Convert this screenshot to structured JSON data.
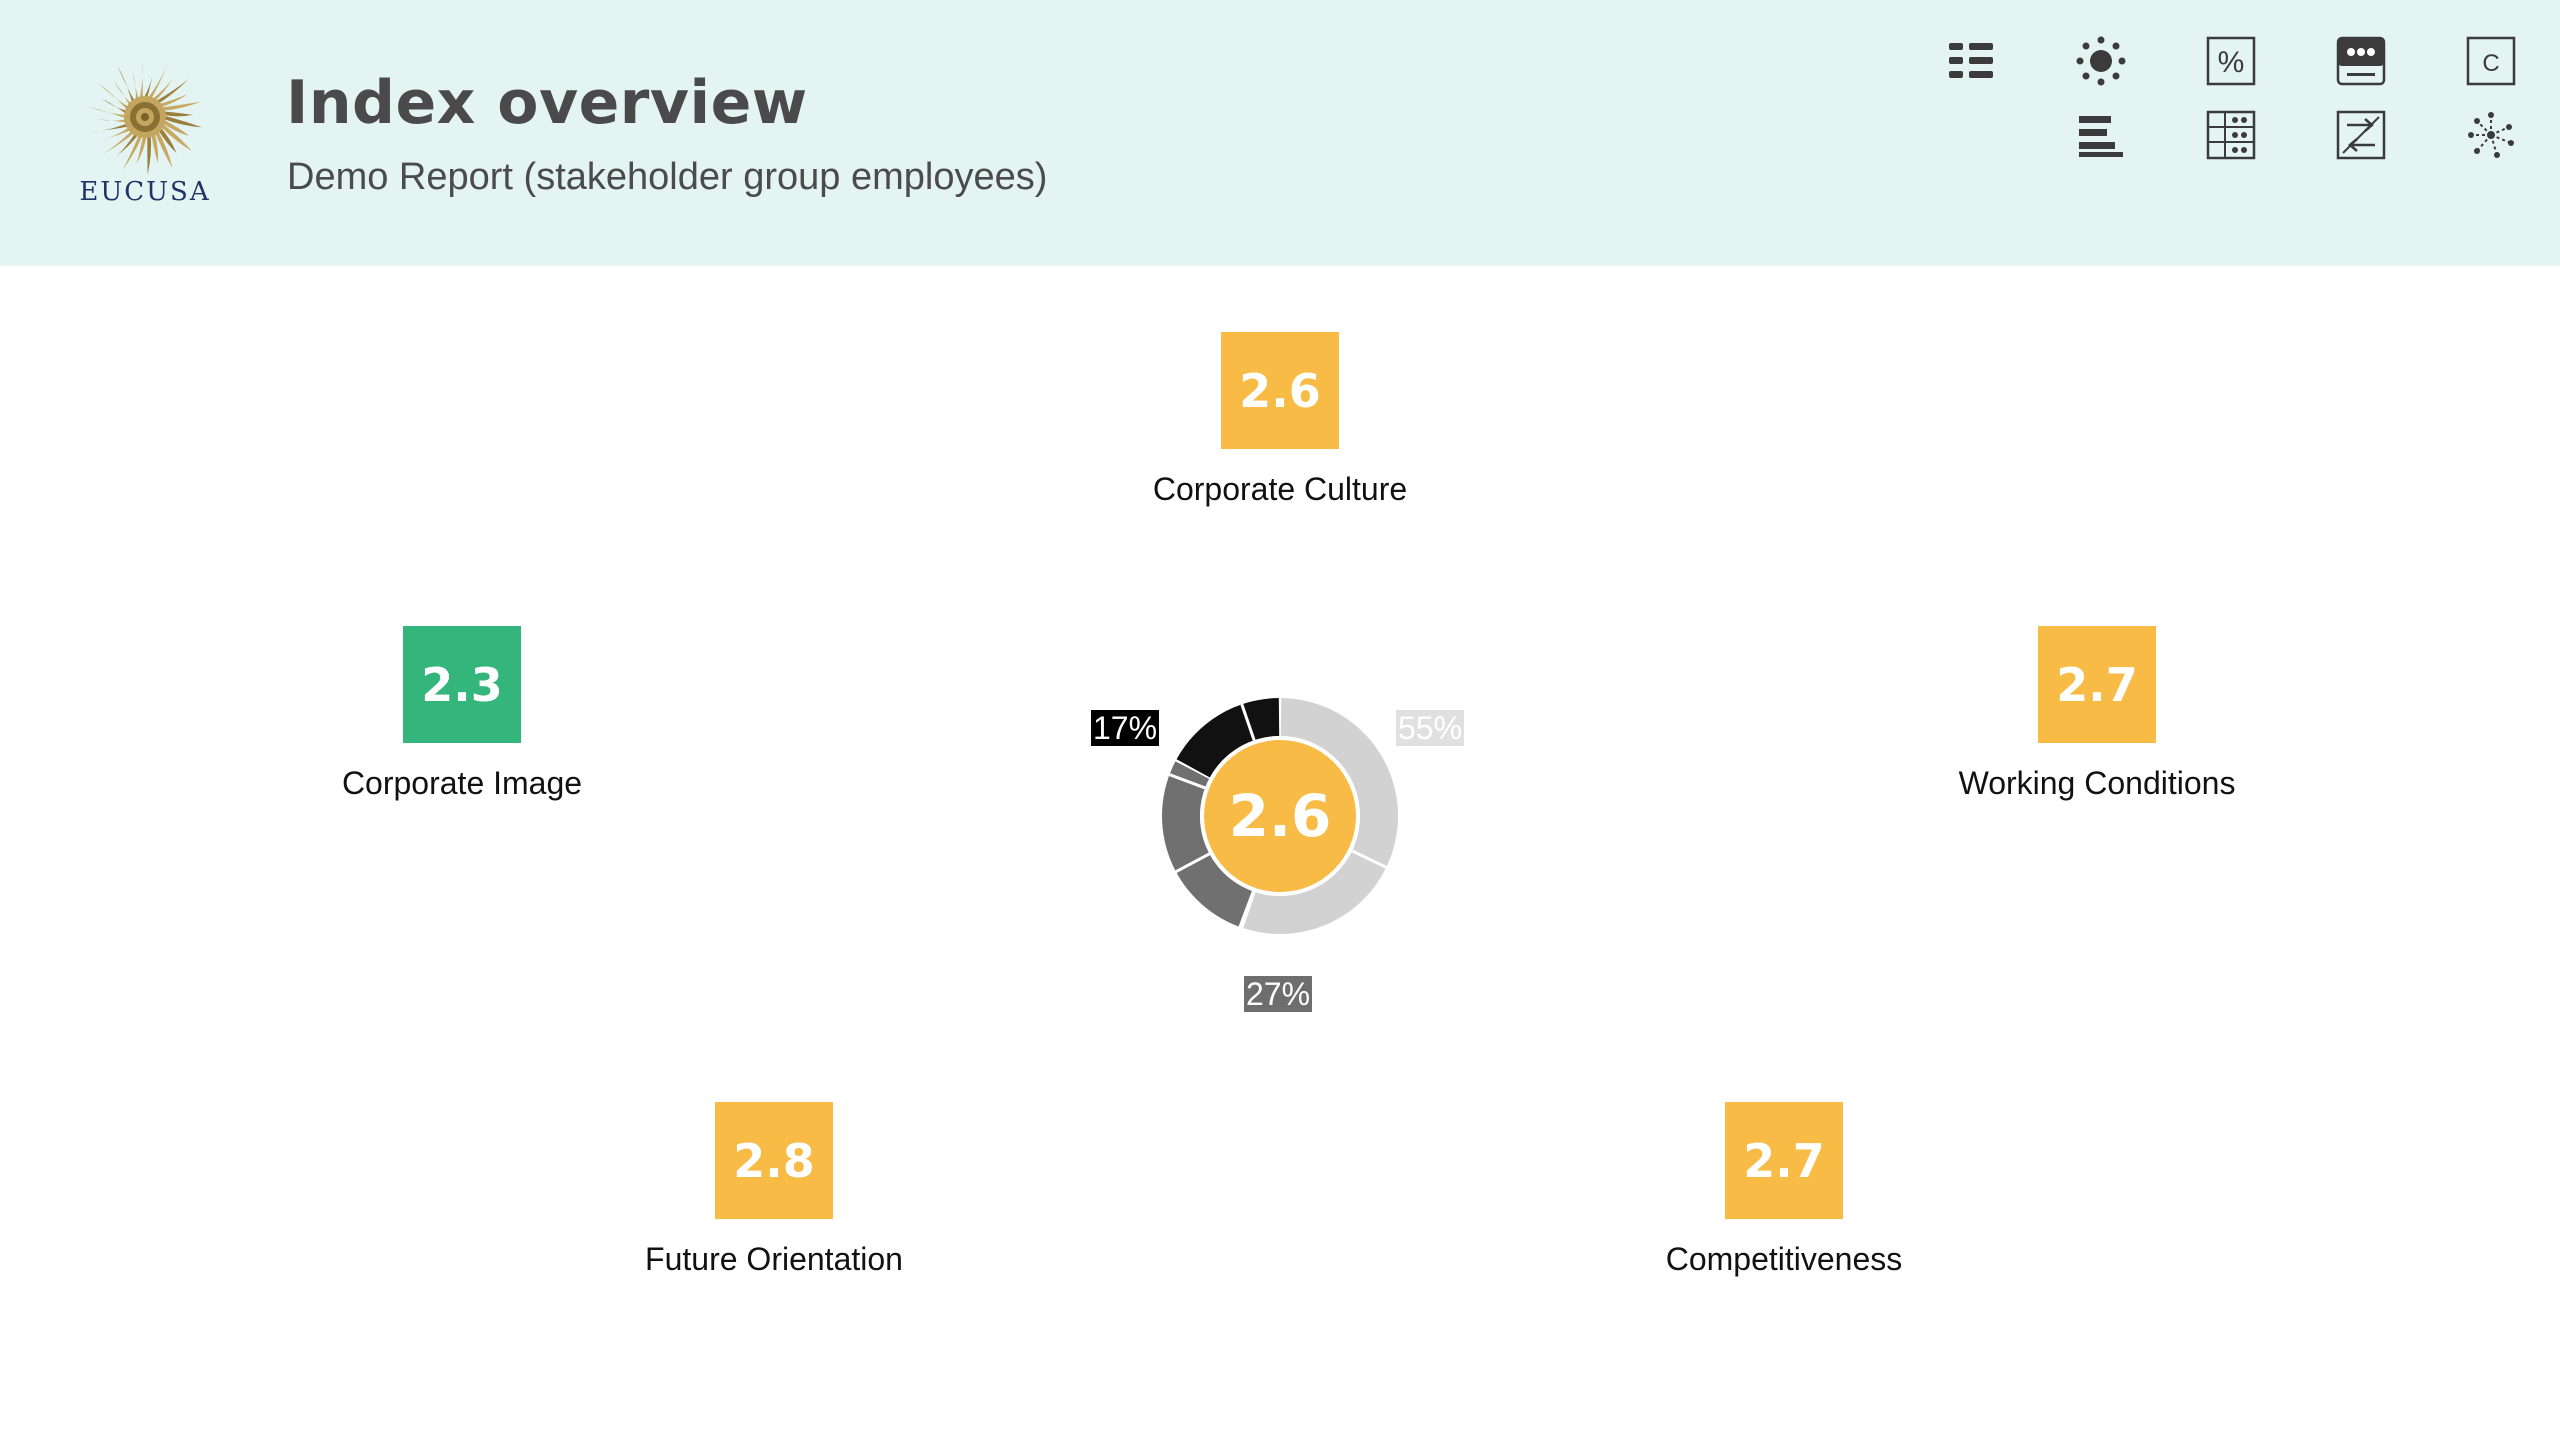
{
  "header": {
    "brand": "EUCUSA",
    "title": "Index overview",
    "subtitle": "Demo Report (stakeholder group employees)"
  },
  "toolbar": {
    "buttons": [
      {
        "name": "list-view-icon"
      },
      {
        "name": "sun-icon"
      },
      {
        "name": "percent-icon",
        "glyph": "%"
      },
      {
        "name": "dots-panel-icon"
      },
      {
        "name": "letter-c-icon",
        "glyph": "C"
      },
      {
        "name": "bar-sort-icon"
      },
      {
        "name": "grid-table-icon"
      },
      {
        "name": "swap-arrows-icon"
      },
      {
        "name": "network-icon"
      }
    ]
  },
  "center": {
    "score": "2.6",
    "segments": [
      {
        "label": "55%",
        "value": 55,
        "color": "#d2d2d2"
      },
      {
        "label": "27%",
        "value": 27,
        "color": "#707070"
      },
      {
        "label": "17%",
        "value": 17,
        "color": "#111111"
      }
    ]
  },
  "dimensions": [
    {
      "name": "Corporate Culture",
      "score": "2.6",
      "color": "#f7bb46"
    },
    {
      "name": "Corporate Image",
      "score": "2.3",
      "color": "#34b57b"
    },
    {
      "name": "Working Conditions",
      "score": "2.7",
      "color": "#f7bb46"
    },
    {
      "name": "Future Orientation",
      "score": "2.8",
      "color": "#f7bb46"
    },
    {
      "name": "Competitiveness",
      "score": "2.7",
      "color": "#f7bb46"
    }
  ],
  "colors": {
    "header_bg": "#e3f4f2",
    "amber": "#f7bb46",
    "green": "#34b57b",
    "icon": "#3b3b3b"
  }
}
